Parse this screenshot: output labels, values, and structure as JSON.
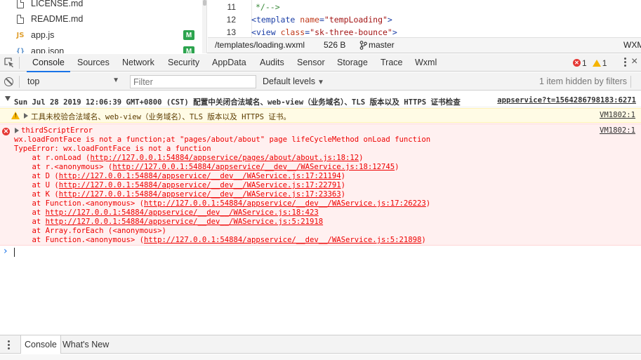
{
  "file_tree": {
    "items": [
      {
        "name": "LICENSE.md",
        "icon": "file-icon",
        "badge": ""
      },
      {
        "name": "README.md",
        "icon": "file-icon",
        "badge": ""
      },
      {
        "name": "app.js",
        "icon": "js-file-icon",
        "icon_text": "JS",
        "badge": "M"
      },
      {
        "name": "app.json",
        "icon": "json-file-icon",
        "icon_text": "{}",
        "badge": "M"
      }
    ],
    "badge_color": "#2ca44e"
  },
  "editor": {
    "lines": [
      {
        "num": "11",
        "comment": "*/-->"
      },
      {
        "num": "12",
        "open": "<",
        "tag": "template",
        "attr": "name",
        "eq": "=",
        "value": "\"tempLoading\"",
        "close": ">"
      },
      {
        "num": "13",
        "open": "<",
        "tag": "view",
        "attr": "class",
        "eq": "=",
        "value": "\"sk-three-bounce\"",
        "close": ">"
      }
    ]
  },
  "statusbar": {
    "path": "/templates/loading.wxml",
    "size": "526 B",
    "branch_icon": "git-branch-icon",
    "branch": "master",
    "language": "WXML"
  },
  "devtools_tabs": {
    "items": [
      "Console",
      "Sources",
      "Network",
      "Security",
      "AppData",
      "Audits",
      "Sensor",
      "Storage",
      "Trace",
      "Wxml"
    ],
    "active": "Console",
    "error_count": "1",
    "warning_count": "1",
    "accent": "#1a73e8"
  },
  "console_toolbar": {
    "context": "top",
    "filter_placeholder": "Filter",
    "levels": "Default levels",
    "hidden_note": "1 item hidden by filters"
  },
  "messages": {
    "group": {
      "text": "Sun Jul 28 2019 12:06:39 GMT+0800 (CST) 配置中关闭合法域名、web-view（业务域名）、TLS 版本以及 HTTPS 证书检查",
      "source": "appservice?t=1564286798183:6271"
    },
    "warning": {
      "text": "工具未校验合法域名、web-view（业务域名）、TLS 版本以及 HTTPS 证书。",
      "source": "VM1802:1"
    },
    "error": {
      "title": "thirdScriptError",
      "source": "VM1802:1",
      "message": "wx.loadFontFace is not a function;at \"pages/about/about\" page lifeCycleMethod onLoad function",
      "type_line": "TypeError: wx.loadFontFace is not a function",
      "stack": [
        {
          "prefix": "    at r.onLoad (",
          "url": "http://127.0.0.1:54884/appservice/pages/about/about.js:18:12",
          "suffix": ")"
        },
        {
          "prefix": "    at r.<anonymous> (",
          "url": "http://127.0.0.1:54884/appservice/__dev__/WAService.js:18:12745",
          "suffix": ")"
        },
        {
          "prefix": "    at D (",
          "url": "http://127.0.0.1:54884/appservice/__dev__/WAService.js:17:21194",
          "suffix": ")"
        },
        {
          "prefix": "    at U (",
          "url": "http://127.0.0.1:54884/appservice/__dev__/WAService.js:17:22791",
          "suffix": ")"
        },
        {
          "prefix": "    at K (",
          "url": "http://127.0.0.1:54884/appservice/__dev__/WAService.js:17:23363",
          "suffix": ")"
        },
        {
          "prefix": "    at Function.<anonymous> (",
          "url": "http://127.0.0.1:54884/appservice/__dev__/WAService.js:17:26223",
          "suffix": ")"
        },
        {
          "prefix": "    at ",
          "url": "http://127.0.0.1:54884/appservice/__dev__/WAService.js:18:423",
          "suffix": ""
        },
        {
          "prefix": "    at ",
          "url": "http://127.0.0.1:54884/appservice/__dev__/WAService.js:5:21918",
          "suffix": ""
        },
        {
          "prefix": "    at Array.forEach (<anonymous>)",
          "url": "",
          "suffix": ""
        },
        {
          "prefix": "    at Function.<anonymous> (",
          "url": "http://127.0.0.1:54884/appservice/__dev__/WAService.js:5:21898",
          "suffix": ")"
        }
      ]
    }
  },
  "drawer": {
    "tabs": [
      "Console",
      "What's New"
    ],
    "active": "Console"
  }
}
